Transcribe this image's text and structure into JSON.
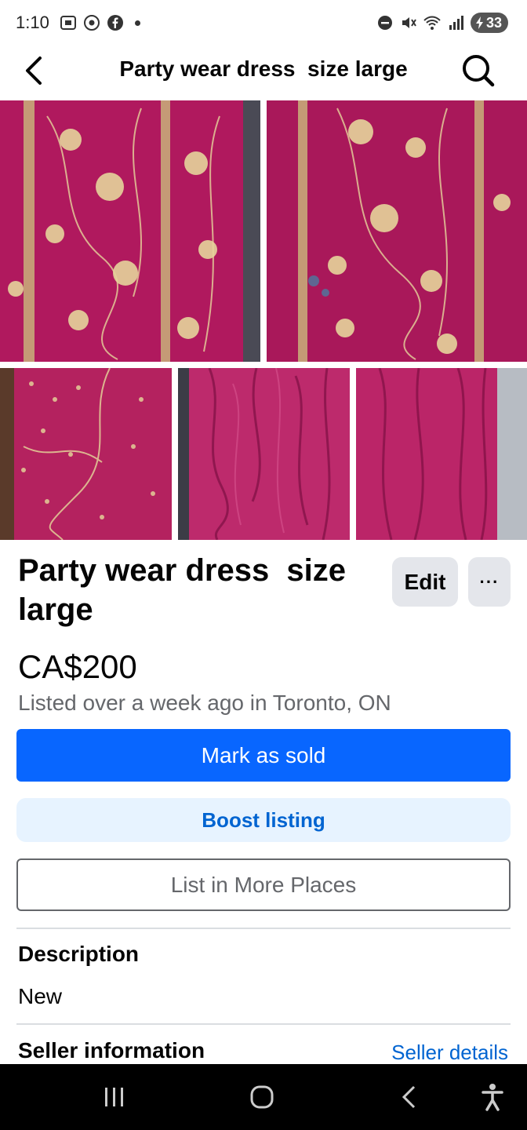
{
  "status_bar": {
    "time": "1:10",
    "battery": "33",
    "icons": [
      "screenshot-icon",
      "chrome-icon",
      "facebook-icon",
      "dnd-icon",
      "mute-icon",
      "wifi-icon",
      "signal-icon",
      "battery-icon"
    ]
  },
  "header": {
    "title": "Party wear dress  size large",
    "back_icon": "chevron-left-icon",
    "search_icon": "search-icon"
  },
  "photos": {
    "count": 5,
    "colors": {
      "fabric": "#b0195e",
      "fabric_dark": "#7e0f43",
      "embroidery": "#d9c58a"
    }
  },
  "listing": {
    "title": "Party wear dress  size large",
    "price": "CA$200",
    "meta": "Listed over a week ago in Toronto, ON",
    "edit_label": "Edit",
    "more_label": "···"
  },
  "actions": {
    "mark_sold": "Mark as sold",
    "boost": "Boost listing",
    "list_more": "List in More Places"
  },
  "description": {
    "heading": "Description",
    "text": "New"
  },
  "seller": {
    "heading": "Seller information",
    "link": "Seller details"
  },
  "colors": {
    "primary": "#0866ff",
    "boost_bg": "#e7f3ff",
    "link": "#0064d1",
    "secondary_text": "#65676b"
  },
  "nav_bar": {
    "items": [
      "recent-apps-icon",
      "home-icon",
      "back-icon",
      "accessibility-icon"
    ]
  }
}
